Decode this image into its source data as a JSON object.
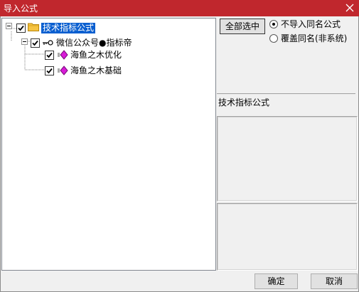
{
  "window": {
    "title": "导入公式",
    "close_glyph": "✕"
  },
  "tree": {
    "root": {
      "label": "技术指标公式",
      "checked": true,
      "expanded": true,
      "selected": true
    },
    "child": {
      "label": "微信公众号●指标帝",
      "checked": true,
      "expanded": true
    },
    "items": [
      {
        "label": "海鱼之木优化",
        "checked": true
      },
      {
        "label": "海鱼之木基础",
        "checked": true
      }
    ]
  },
  "options": {
    "select_all_label": "全部选中",
    "radios": [
      {
        "label": "不导入同名公式",
        "selected": true
      },
      {
        "label": "覆盖同名(非系统)",
        "selected": false
      }
    ]
  },
  "detail": {
    "name": "技术指标公式",
    "description": "",
    "formula": ""
  },
  "footer": {
    "ok_label": "确定",
    "cancel_label": "取消"
  },
  "colors": {
    "titlebar": "#c0272d",
    "selection": "#0a5fd0",
    "diamond": "#d81bd8",
    "folder": "#f5c342"
  }
}
